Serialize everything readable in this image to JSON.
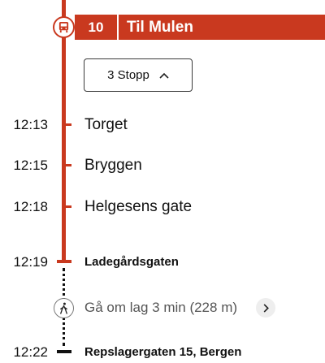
{
  "line": {
    "number": "10",
    "destination": "Til Mulen",
    "color": "#c9391f",
    "icon": "bus-icon"
  },
  "stops_toggle": {
    "label": "3 Stopp",
    "icon": "chevron-up-icon"
  },
  "stops": [
    {
      "time": "12:13",
      "name": "Torget"
    },
    {
      "time": "12:15",
      "name": "Bryggen"
    },
    {
      "time": "12:18",
      "name": "Helgesens gate"
    },
    {
      "time": "12:19",
      "name": "Ladegårdsgaten"
    }
  ],
  "walk": {
    "text": "Gå om lag 3 min (228 m)",
    "icon": "walk-icon",
    "chevron_icon": "chevron-right-icon"
  },
  "destination": {
    "time": "12:22",
    "name": "Repslagergaten 15, Bergen"
  }
}
